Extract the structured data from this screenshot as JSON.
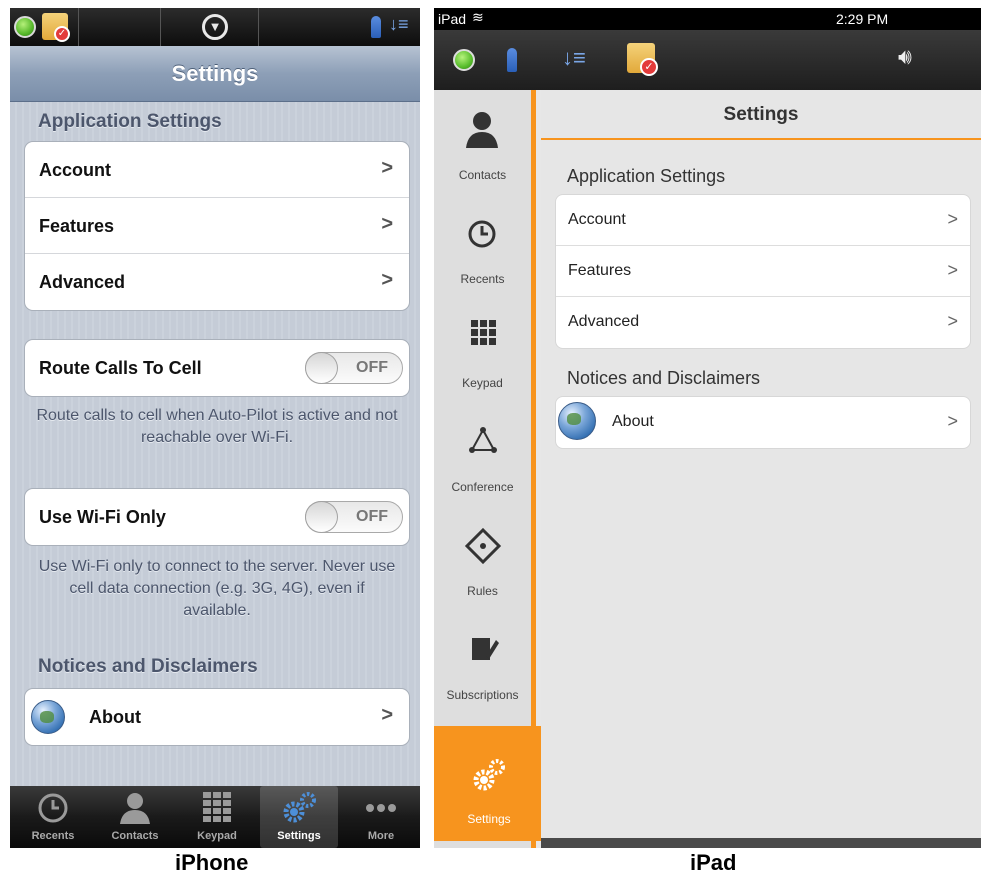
{
  "iphone": {
    "status_icons": [
      "status-green-icon",
      "calendar-check-icon",
      "dropdown-icon",
      "person-icon",
      "sort-icon"
    ],
    "nav_title": "Settings",
    "section_app": "Application Settings",
    "rows": [
      {
        "label": "Account",
        "chevron": ">"
      },
      {
        "label": "Features",
        "chevron": ">"
      },
      {
        "label": "Advanced",
        "chevron": ">"
      }
    ],
    "route_calls": {
      "label": "Route Calls To Cell",
      "switch": "OFF",
      "note": "Route calls to cell when Auto-Pilot is active and not reachable over Wi-Fi."
    },
    "wifi_only": {
      "label": "Use Wi-Fi Only",
      "switch": "OFF",
      "note": "Use Wi-Fi only to connect to the server. Never use cell data connection (e.g. 3G, 4G), even if available."
    },
    "section_notices": "Notices and Disclaimers",
    "about": {
      "label": "About",
      "chevron": ">"
    },
    "tabs": [
      {
        "label": "Recents",
        "icon": "clock-icon"
      },
      {
        "label": "Contacts",
        "icon": "person-icon"
      },
      {
        "label": "Keypad",
        "icon": "keypad-icon"
      },
      {
        "label": "Settings",
        "icon": "gears-icon",
        "selected": true
      },
      {
        "label": "More",
        "icon": "more-dots-icon"
      }
    ],
    "caption": "iPhone"
  },
  "ipad": {
    "status": {
      "device": "iPad",
      "time": "2:29 PM"
    },
    "topbar_icons": [
      "status-green-icon",
      "person-icon",
      "sort-icon",
      "calendar-check-icon",
      "speaker-icon"
    ],
    "nav": [
      {
        "label": "Contacts",
        "icon": "person-icon"
      },
      {
        "label": "Recents",
        "icon": "clock-icon"
      },
      {
        "label": "Keypad",
        "icon": "keypad-icon"
      },
      {
        "label": "Conference",
        "icon": "conference-icon"
      },
      {
        "label": "Rules",
        "icon": "rules-icon"
      },
      {
        "label": "Subscriptions",
        "icon": "subscriptions-icon"
      },
      {
        "label": "Settings",
        "icon": "gears-icon",
        "selected": true
      }
    ],
    "title": "Settings",
    "section_app": "Application Settings",
    "rows": [
      {
        "label": "Account",
        "chevron": ">"
      },
      {
        "label": "Features",
        "chevron": ">"
      },
      {
        "label": "Advanced",
        "chevron": ">"
      }
    ],
    "section_notices": "Notices and Disclaimers",
    "about": {
      "label": "About",
      "chevron": ">"
    },
    "accent": "#f7941e",
    "caption": "iPad"
  }
}
